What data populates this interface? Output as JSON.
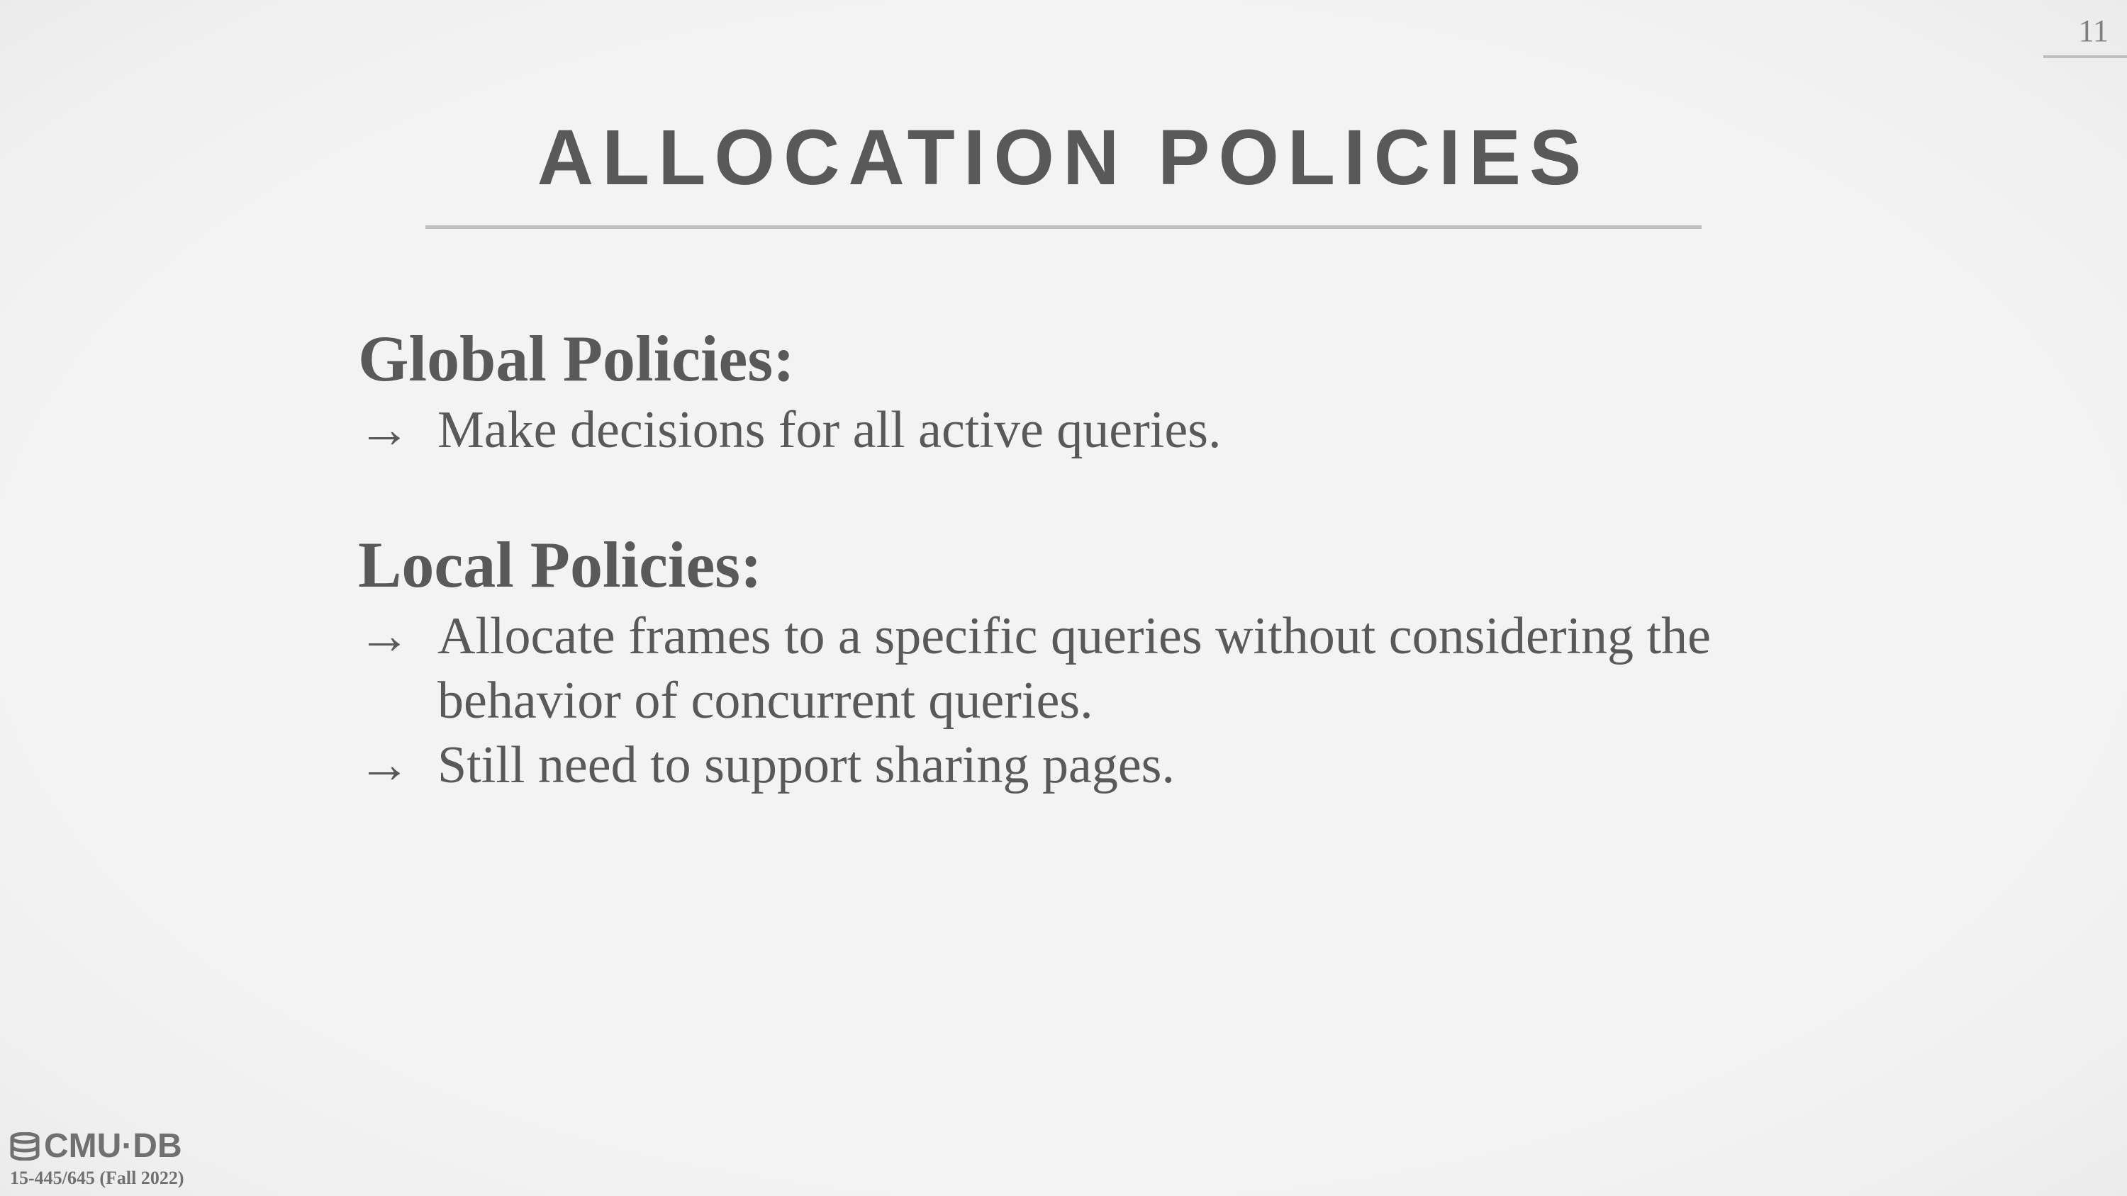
{
  "slide": {
    "number": "11",
    "title": "ALLOCATION POLICIES"
  },
  "sections": [
    {
      "heading": "Global Policies:",
      "bullets": [
        "Make decisions for all active queries."
      ]
    },
    {
      "heading": "Local Policies:",
      "bullets": [
        "Allocate frames to a specific queries without considering the behavior of concurrent queries.",
        "Still need to support sharing pages."
      ]
    }
  ],
  "bullet_glyph": "→",
  "footer": {
    "logo_text": "CMU·DB",
    "course": "15-445/645 (Fall 2022)"
  },
  "colors": {
    "background": "#f2f2f2",
    "text": "#595959",
    "rule": "#bfbfbf"
  },
  "icons": {
    "logo": "database-icon"
  }
}
